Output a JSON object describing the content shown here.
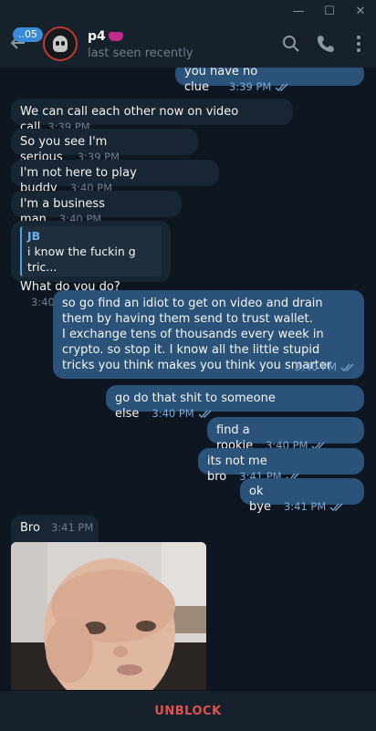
{
  "window": {
    "minimize": "—",
    "maximize": "☐",
    "close": "✕"
  },
  "header": {
    "back_icon": "arrow-left-icon",
    "unread_count": "..05",
    "name": "p4",
    "status": "last seen recently",
    "icons": [
      "search-icon",
      "phone-icon",
      "more-vertical-icon"
    ]
  },
  "messages": [
    {
      "dir": "out",
      "text": "you have no clue",
      "time": "3:39 PM"
    },
    {
      "dir": "in",
      "text": "We can call each other now on video call",
      "time": "3:39 PM"
    },
    {
      "dir": "in",
      "text": "So you see I'm serious",
      "time": "3:39 PM"
    },
    {
      "dir": "in",
      "text": "I'm not here to play buddy",
      "time": "3:40 PM"
    },
    {
      "dir": "in",
      "text": "I'm a business man",
      "time": "3:40 PM"
    },
    {
      "dir": "in",
      "reply_name": "JB",
      "reply_text": "i know the fuckin g tric...",
      "text": "What do you do?",
      "time": "3:40 PM"
    },
    {
      "dir": "out",
      "text": "so go find an idiot to get on video and drain them by having them send to trust wallet.\nI exchange tens of thousands every week in crypto. so stop it. I know all the little stupid tricks you think makes you think you smarter.",
      "time": "3:40 PM"
    },
    {
      "dir": "out",
      "text": "go do that shit to someone else",
      "time": "3:40 PM"
    },
    {
      "dir": "out",
      "text": "find a rookie",
      "time": "3:40 PM"
    },
    {
      "dir": "out",
      "text": "its not me bro",
      "time": "3:41 PM"
    },
    {
      "dir": "out",
      "text": "ok bye",
      "time": "3:41 PM"
    },
    {
      "dir": "in",
      "text": "Bro",
      "time": "3:41 PM"
    }
  ],
  "bottom": {
    "action": "UNBLOCK"
  },
  "colors": {
    "background": "#0e1621",
    "outgoing": "#2b5278",
    "incoming": "#182533",
    "accent": "#4da3e6",
    "unblock": "#e05252"
  }
}
